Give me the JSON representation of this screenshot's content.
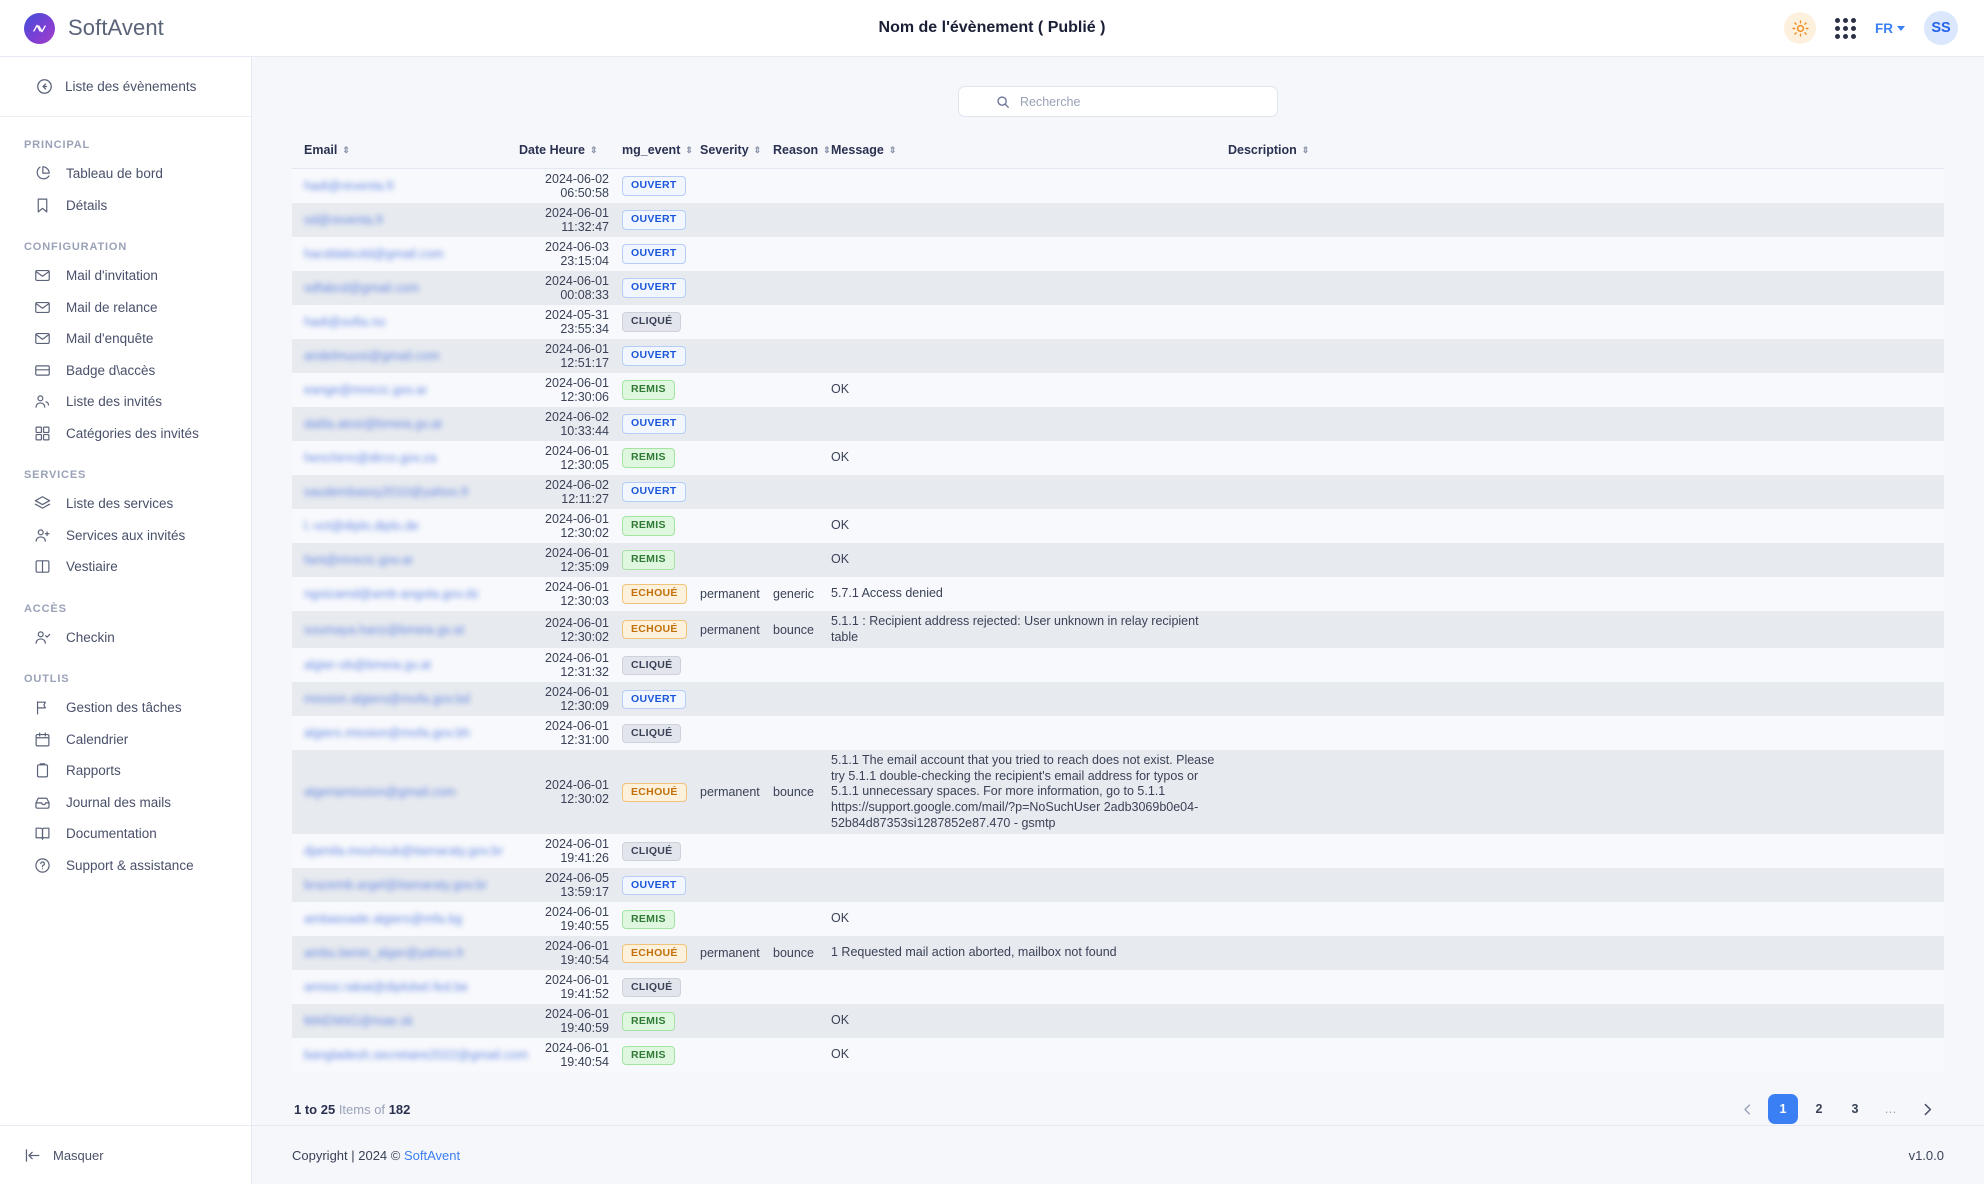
{
  "topbar": {
    "logo_text": "AV",
    "brand": "SoftAvent",
    "title": "Nom de l'évènement ( Publié )",
    "theme_icon": "sun-icon",
    "apps_icon": "grid-apps-icon",
    "language": "FR",
    "avatar_initials": "SS"
  },
  "sidebar": {
    "back_label": "Liste des évènements",
    "hide_label": "Masquer",
    "groups": [
      {
        "title": "PRINCIPAL",
        "items": [
          {
            "label": "Tableau de bord",
            "icon": "pie-chart-icon"
          },
          {
            "label": "Détails",
            "icon": "bookmark-icon"
          }
        ]
      },
      {
        "title": "CONFIGURATION",
        "items": [
          {
            "label": "Mail d'invitation",
            "icon": "envelope-icon"
          },
          {
            "label": "Mail de relance",
            "icon": "envelope-icon"
          },
          {
            "label": "Mail d'enquête",
            "icon": "envelope-icon"
          },
          {
            "label": "Badge d\\accès",
            "icon": "badge-card-icon"
          },
          {
            "label": "Liste des invités",
            "icon": "users-icon"
          },
          {
            "label": "Catégories des invités",
            "icon": "grid-squares-icon"
          }
        ]
      },
      {
        "title": "SERVICES",
        "items": [
          {
            "label": "Liste des services",
            "icon": "layers-icon"
          },
          {
            "label": "Services aux invités",
            "icon": "user-plus-icon"
          },
          {
            "label": "Vestiaire",
            "icon": "columns-icon"
          }
        ]
      },
      {
        "title": "ACCÈS",
        "items": [
          {
            "label": "Checkin",
            "icon": "user-check-icon"
          }
        ]
      },
      {
        "title": "OUTLIS",
        "items": [
          {
            "label": "Gestion des tâches",
            "icon": "flag-icon"
          },
          {
            "label": "Calendrier",
            "icon": "calendar-icon"
          },
          {
            "label": "Rapports",
            "icon": "clipboard-icon"
          },
          {
            "label": "Journal des mails",
            "icon": "inbox-icon"
          },
          {
            "label": "Documentation",
            "icon": "book-icon"
          },
          {
            "label": "Support & assistance",
            "icon": "help-circle-icon"
          }
        ]
      }
    ]
  },
  "search": {
    "placeholder": "Recherche",
    "value": "",
    "icon": "search-icon"
  },
  "table": {
    "columns": [
      {
        "key": "email",
        "label": "Email"
      },
      {
        "key": "date",
        "label": "Date Heure"
      },
      {
        "key": "event",
        "label": "mg_event"
      },
      {
        "key": "severity",
        "label": "Severity"
      },
      {
        "key": "reason",
        "label": "Reason"
      },
      {
        "key": "message",
        "label": "Message"
      },
      {
        "key": "description",
        "label": "Description"
      }
    ],
    "rows": [
      {
        "email": "hadi@reventa.fr",
        "date": "2024-06-02 06:50:58",
        "event": "OUVERT",
        "severity": "",
        "reason": "",
        "message": "",
        "description": ""
      },
      {
        "email": "sd@reventa.fr",
        "date": "2024-06-01 11:32:47",
        "event": "OUVERT",
        "severity": "",
        "reason": "",
        "message": "",
        "description": ""
      },
      {
        "email": "hacddabcdd@gmail.com",
        "date": "2024-06-03 23:15:04",
        "event": "OUVERT",
        "severity": "",
        "reason": "",
        "message": "",
        "description": ""
      },
      {
        "email": "sdfabcd@gmail.com",
        "date": "2024-06-01 00:08:33",
        "event": "OUVERT",
        "severity": "",
        "reason": "",
        "message": "",
        "description": ""
      },
      {
        "email": "hadi@sofia.no",
        "date": "2024-05-31 23:55:34",
        "event": "CLIQUÉ",
        "severity": "",
        "reason": "",
        "message": "",
        "description": ""
      },
      {
        "email": "andelmuosi@gmail.com",
        "date": "2024-06-01 12:51:17",
        "event": "OUVERT",
        "severity": "",
        "reason": "",
        "message": "",
        "description": ""
      },
      {
        "email": "eange@mrecic.gov.ar",
        "date": "2024-06-01 12:30:06",
        "event": "REMIS",
        "severity": "",
        "reason": "",
        "message": "OK",
        "description": ""
      },
      {
        "email": "dalila.atosi@bmeia.gv.at",
        "date": "2024-06-02 10:33:44",
        "event": "OUVERT",
        "severity": "",
        "reason": "",
        "message": "",
        "description": ""
      },
      {
        "email": "henchirm@dirco.gov.za",
        "date": "2024-06-01 12:30:05",
        "event": "REMIS",
        "severity": "",
        "reason": "",
        "message": "OK",
        "description": ""
      },
      {
        "email": "saudembassy2010@yahoo.fr",
        "date": "2024-06-02 12:11:27",
        "event": "OUVERT",
        "severity": "",
        "reason": "",
        "message": "",
        "description": ""
      },
      {
        "email": "l.-vct@diplo.diplo.de",
        "date": "2024-06-01 12:30:02",
        "event": "REMIS",
        "severity": "",
        "reason": "",
        "message": "OK",
        "description": ""
      },
      {
        "email": "fant@mrecic.gov.ar",
        "date": "2024-06-01 12:35:09",
        "event": "REMIS",
        "severity": "",
        "reason": "",
        "message": "OK",
        "description": ""
      },
      {
        "email": "ngoizamd@amb-angola.gov.dz",
        "date": "2024-06-01 12:30:03",
        "event": "ECHOUÉ",
        "severity": "permanent",
        "reason": "generic",
        "message": "5.7.1 Access denied",
        "description": ""
      },
      {
        "email": "soumaya.hariz@bmeia.gv.at",
        "date": "2024-06-01 12:30:02",
        "event": "ECHOUÉ",
        "severity": "permanent",
        "reason": "bounce",
        "message": "5.1.1 : Recipient address rejected: User unknown in relay recipient table",
        "description": ""
      },
      {
        "email": "algier-ob@bmeia.gv.at",
        "date": "2024-06-01 12:31:32",
        "event": "CLIQUÉ",
        "severity": "",
        "reason": "",
        "message": "",
        "description": ""
      },
      {
        "email": "mission.algiers@mofa.gov.bd",
        "date": "2024-06-01 12:30:09",
        "event": "OUVERT",
        "severity": "",
        "reason": "",
        "message": "",
        "description": ""
      },
      {
        "email": "algiers.mission@mofa.gov.bh",
        "date": "2024-06-01 12:31:00",
        "event": "CLIQUÉ",
        "severity": "",
        "reason": "",
        "message": "",
        "description": ""
      },
      {
        "email": "algeriamission@gmail.com",
        "date": "2024-06-01 12:30:02",
        "event": "ECHOUÉ",
        "severity": "permanent",
        "reason": "bounce",
        "message": "5.1.1 The email account that you tried to reach does not exist. Please try 5.1.1 double-checking the recipient's email address for typos or 5.1.1 unnecessary spaces. For more information, go to 5.1.1 https://support.google.com/mail/?p=NoSuchUser 2adb3069b0e04-52b84d87353si1287852e87.470 - gsmtp",
        "description": "",
        "tall": true
      },
      {
        "email": "djamila.mouhoub@itamaraty.gov.br",
        "date": "2024-06-01 19:41:26",
        "event": "CLIQUÉ",
        "severity": "",
        "reason": "",
        "message": "",
        "description": ""
      },
      {
        "email": "brazemb.argel@itamaraty.gov.br",
        "date": "2024-06-05 13:59:17",
        "event": "OUVERT",
        "severity": "",
        "reason": "",
        "message": "",
        "description": ""
      },
      {
        "email": "ambassade.algiers@mfa.bg",
        "date": "2024-06-01 19:40:55",
        "event": "REMIS",
        "severity": "",
        "reason": "",
        "message": "OK",
        "description": ""
      },
      {
        "email": "ambu.benin_alger@yahoo.fr",
        "date": "2024-06-01 19:40:54",
        "event": "ECHOUÉ",
        "severity": "permanent",
        "reason": "bounce",
        "message": "1 Requested mail action aborted, mailbox not found",
        "description": ""
      },
      {
        "email": "amissi.rabat@diplobel.fed.be",
        "date": "2024-06-01 19:41:52",
        "event": "CLIQUÉ",
        "severity": "",
        "reason": "",
        "message": "",
        "description": ""
      },
      {
        "email": "MAENNG@mae.sk",
        "date": "2024-06-01 19:40:59",
        "event": "REMIS",
        "severity": "",
        "reason": "",
        "message": "OK",
        "description": ""
      },
      {
        "email": "bangladesh.secretaire2022@gmail.com",
        "date": "2024-06-01 19:40:54",
        "event": "REMIS",
        "severity": "",
        "reason": "",
        "message": "OK",
        "description": ""
      }
    ]
  },
  "pagination": {
    "range_prefix": "1 to 25",
    "range_mid": "Items of",
    "total": "182",
    "prev_icon": "chevron-left-icon",
    "next_icon": "chevron-right-icon",
    "pages": [
      "1",
      "2",
      "3",
      "…"
    ],
    "active_page": "1",
    "accent_color": "#3b7ff5"
  },
  "footer": {
    "copyright_pre": "Copyright | 2024 ©",
    "brand_link": "SoftAvent",
    "version": "v1.0.0"
  }
}
